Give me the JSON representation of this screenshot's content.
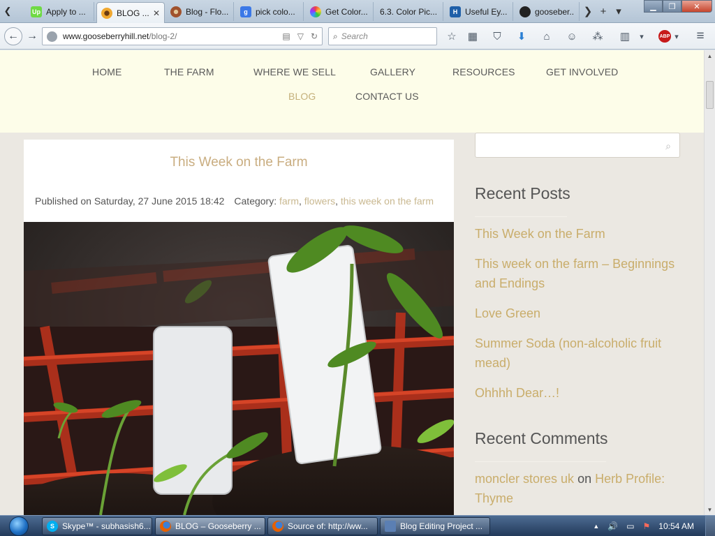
{
  "browser": {
    "tabs": [
      {
        "title": "Apply to ...",
        "icon": "upwork-icon",
        "favicon_text": "Up",
        "favicon_color": "#6fda44",
        "active": false
      },
      {
        "title": "BLOG ...",
        "icon": "sunflower-icon",
        "favicon_text": "",
        "favicon_color": "#f0a830",
        "active": true
      },
      {
        "title": "Blog - Flo...",
        "icon": "flower-icon",
        "favicon_text": "",
        "favicon_color": "#a0522d",
        "active": false
      },
      {
        "title": "pick colo...",
        "icon": "google-icon",
        "favicon_text": "g",
        "favicon_color": "#3b78e7",
        "active": false
      },
      {
        "title": "Get Color...",
        "icon": "color-wheel-icon",
        "favicon_text": "",
        "favicon_color": "#e44",
        "active": false
      },
      {
        "title": "6.3. Color Pic...",
        "icon": "page-icon",
        "favicon_text": "",
        "favicon_color": "#b9c6d3",
        "active": false
      },
      {
        "title": "Useful Ey...",
        "icon": "h-icon",
        "favicon_text": "H",
        "favicon_color": "#1f5fa8",
        "active": false
      },
      {
        "title": "gooseber...",
        "icon": "github-icon",
        "favicon_text": "",
        "favicon_color": "#222",
        "active": false
      }
    ],
    "tab_close_glyph": "✕",
    "scroll_left_glyph": "❮",
    "scroll_right_glyph": "❯",
    "new_tab_glyph": "+",
    "tab_list_glyph": "▾",
    "window_controls": {
      "minimize": "▁",
      "maximize": "❐",
      "close": "✕"
    },
    "back_glyph": "←",
    "forward_glyph": "→",
    "url": {
      "host": "www.gooseberryhill.net",
      "path": "/blog-2/"
    },
    "url_icons": {
      "reader": "▤",
      "dropdown": "▽",
      "reload": "↻"
    },
    "search_placeholder": "Search",
    "search_glyph": "⌕",
    "toolbar_glyphs": {
      "bookmark": "☆",
      "reading_list": "▦",
      "pocket": "⛉",
      "downloads": "⬇",
      "home": "⌂",
      "chat": "☺",
      "share": "⁂",
      "clipboard": "▥",
      "more": "▾",
      "abp": "ABP",
      "abp_more": "▾",
      "menu": "≡"
    }
  },
  "site": {
    "nav": [
      {
        "label": "HOME",
        "current": false
      },
      {
        "label": "THE FARM",
        "current": false
      },
      {
        "label": "WHERE WE SELL",
        "current": false
      },
      {
        "label": "GALLERY",
        "current": false
      },
      {
        "label": "RESOURCES",
        "current": false
      },
      {
        "label": "GET INVOLVED",
        "current": false
      },
      {
        "label": "BLOG",
        "current": true
      },
      {
        "label": "CONTACT US",
        "current": false
      }
    ],
    "post": {
      "title": "This Week on the Farm",
      "published": "Published on Saturday, 27 June 2015 18:42",
      "category_label": "Category:",
      "categories": [
        "farm",
        "flowers",
        "this week on the farm"
      ],
      "image_alt": "Seedlings in a red tray with plant labels"
    },
    "sidebar": {
      "search_glyph": "⌕",
      "recent_posts_title": "Recent Posts",
      "recent_posts": [
        "This Week on the Farm",
        "This week on the farm – Beginnings and Endings",
        "Love Green",
        "Summer Soda (non-alcoholic fruit mead)",
        "Ohhhh Dear…!"
      ],
      "recent_comments_title": "Recent Comments",
      "recent_comments": [
        {
          "author": "moncler stores uk",
          "on": "on",
          "post": "Herb Profile: Thyme"
        }
      ]
    },
    "colors": {
      "header_bg": "#fdfde9",
      "page_bg": "#ebe8e2",
      "accent": "#c9ad6b",
      "text": "#555555"
    }
  },
  "scrollbar": {
    "up_glyph": "▲",
    "down_glyph": "▼"
  },
  "taskbar": {
    "items": [
      {
        "label": "Skype™ - subhasish6...",
        "icon": "skype-icon",
        "icon_text": "S",
        "icon_color": "#00aff0",
        "active": false
      },
      {
        "label": "BLOG – Gooseberry ...",
        "icon": "firefox-icon",
        "icon_text": "",
        "icon_color": "#e66000",
        "active": true
      },
      {
        "label": "Source of: http://ww...",
        "icon": "firefox-icon",
        "icon_text": "",
        "icon_color": "#e66000",
        "active": false
      },
      {
        "label": "Blog Editing Project ...",
        "icon": "document-icon",
        "icon_text": "",
        "icon_color": "#5b7fb3",
        "active": false
      }
    ],
    "tray": {
      "expand": "▲",
      "volume": "🔊",
      "network": "▭",
      "flag": "⚑"
    },
    "clock": "10:54 AM"
  }
}
